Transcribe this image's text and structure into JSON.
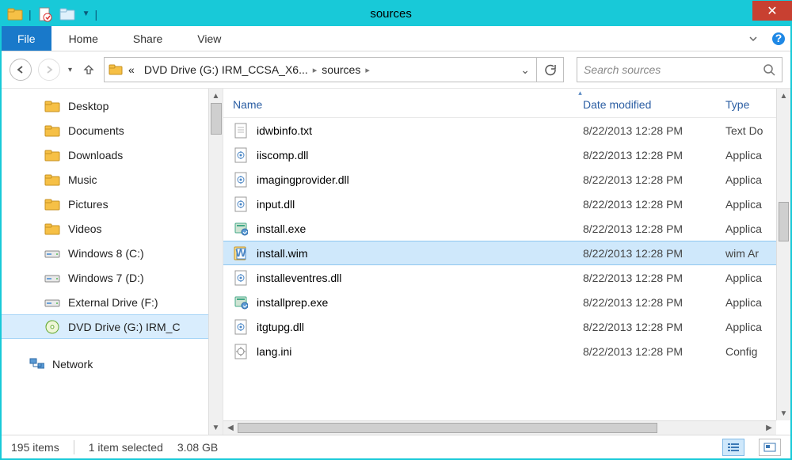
{
  "window": {
    "title": "sources"
  },
  "ribbon": {
    "file_label": "File",
    "tabs": [
      "Home",
      "Share",
      "View"
    ]
  },
  "nav": {
    "crumb_prefix": "«",
    "crumb_drive": "DVD Drive (G:) IRM_CCSA_X6...",
    "crumb_folder": "sources",
    "search_placeholder": "Search sources"
  },
  "tree": {
    "items": [
      {
        "label": "Desktop",
        "icon": "folder"
      },
      {
        "label": "Documents",
        "icon": "folder"
      },
      {
        "label": "Downloads",
        "icon": "folder"
      },
      {
        "label": "Music",
        "icon": "folder"
      },
      {
        "label": "Pictures",
        "icon": "folder"
      },
      {
        "label": "Videos",
        "icon": "folder"
      },
      {
        "label": "Windows 8 (C:)",
        "icon": "drive"
      },
      {
        "label": "Windows 7 (D:)",
        "icon": "drive"
      },
      {
        "label": "External Drive (F:)",
        "icon": "drive"
      },
      {
        "label": "DVD Drive (G:) IRM_C",
        "icon": "dvd",
        "selected": true
      }
    ],
    "network_label": "Network"
  },
  "columns": {
    "name": "Name",
    "date": "Date modified",
    "type": "Type"
  },
  "files": [
    {
      "name": "idwbinfo.txt",
      "date": "8/22/2013 12:28 PM",
      "type": "Text Do",
      "icon": "txt"
    },
    {
      "name": "iiscomp.dll",
      "date": "8/22/2013 12:28 PM",
      "type": "Applica",
      "icon": "dll"
    },
    {
      "name": "imagingprovider.dll",
      "date": "8/22/2013 12:28 PM",
      "type": "Applica",
      "icon": "dll"
    },
    {
      "name": "input.dll",
      "date": "8/22/2013 12:28 PM",
      "type": "Applica",
      "icon": "dll"
    },
    {
      "name": "install.exe",
      "date": "8/22/2013 12:28 PM",
      "type": "Applica",
      "icon": "exe"
    },
    {
      "name": "install.wim",
      "date": "8/22/2013 12:28 PM",
      "type": "wim Ar",
      "icon": "wim",
      "selected": true
    },
    {
      "name": "installeventres.dll",
      "date": "8/22/2013 12:28 PM",
      "type": "Applica",
      "icon": "dll"
    },
    {
      "name": "installprep.exe",
      "date": "8/22/2013 12:28 PM",
      "type": "Applica",
      "icon": "exe"
    },
    {
      "name": "itgtupg.dll",
      "date": "8/22/2013 12:28 PM",
      "type": "Applica",
      "icon": "dll"
    },
    {
      "name": "lang.ini",
      "date": "8/22/2013 12:28 PM",
      "type": "Config",
      "icon": "ini"
    }
  ],
  "status": {
    "items": "195 items",
    "selected": "1 item selected",
    "size": "3.08 GB"
  }
}
